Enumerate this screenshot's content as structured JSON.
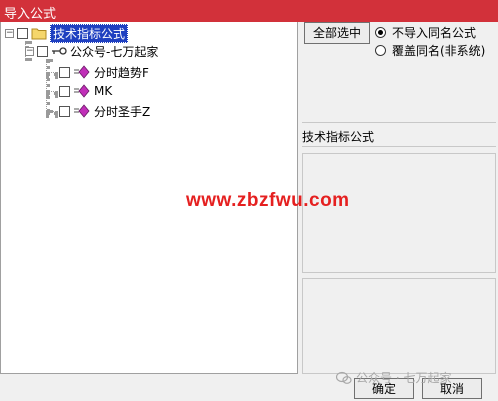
{
  "window": {
    "title": "导入公式"
  },
  "tree": {
    "root": {
      "label": "技术指标公式"
    },
    "group": {
      "label": "公众号-七万起家"
    },
    "items": [
      {
        "label": "分时趋势F"
      },
      {
        "label": "MK"
      },
      {
        "label": "分时圣手Z"
      }
    ]
  },
  "options": {
    "select_all_label": "全部选中",
    "radio_skip_label": "不导入同名公式",
    "radio_overwrite_label": "覆盖同名(非系统)",
    "selected": "radio_skip"
  },
  "description_label": "技术指标公式",
  "footer": {
    "ok_label": "确定",
    "cancel_label": "取消"
  },
  "overlay": {
    "watermark": "www.zbzfwu.com",
    "wechat_mark": "公众号 · 七万起家"
  },
  "colors": {
    "titlebar": "#d2313a",
    "selection": "#1e3fc0",
    "watermark": "#e52020"
  }
}
